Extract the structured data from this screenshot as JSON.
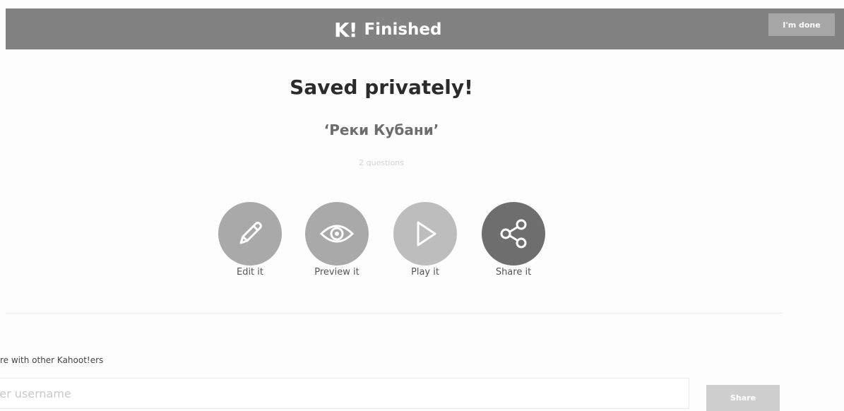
{
  "header": {
    "logo_text": "K!",
    "title": "Finished",
    "done_label": "I'm done"
  },
  "main": {
    "status_title": "Saved privately!",
    "kahoot_name": "‘Реки Кубани’",
    "questions_count": "2 questions"
  },
  "actions": [
    {
      "label": "Edit it",
      "icon": "pencil-icon"
    },
    {
      "label": "Preview it",
      "icon": "eye-icon"
    },
    {
      "label": "Play it",
      "icon": "play-icon"
    },
    {
      "label": "Share it",
      "icon": "share-icon"
    }
  ],
  "share": {
    "label": "re with other Kahoot!ers",
    "placeholder": "ter username",
    "button_label": "Share"
  },
  "colors": {
    "header_bg": "#828282",
    "action_share": "#6e6e6e",
    "action_default": "#a9a9a9"
  }
}
